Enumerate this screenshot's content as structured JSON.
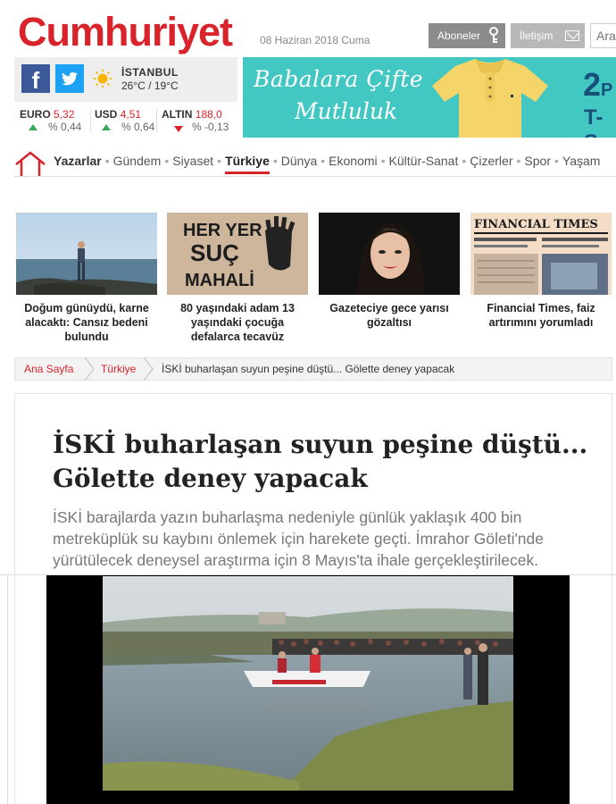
{
  "header": {
    "logo": "Cumhuriyet",
    "date": "08 Haziran 2018 Cuma",
    "subscribe_label": "Aboneler",
    "contact_label": "İletişim",
    "search_placeholder": "Ara"
  },
  "weather": {
    "city": "İSTANBUL",
    "temperature": "26°C / 19°C"
  },
  "currency": [
    {
      "name": "EURO",
      "value": "5,32",
      "change": "% 0,44",
      "direction": "up"
    },
    {
      "name": "USD",
      "value": "4,51",
      "change": "% 0,64",
      "direction": "up"
    },
    {
      "name": "ALTIN",
      "value": "188,0",
      "change": "% -0,13",
      "direction": "down"
    }
  ],
  "banner": {
    "line1": "Babalara Çifte",
    "line2": "Mutluluk",
    "promo_big": "2",
    "promo_letter": "P",
    "promo_small": "T-S"
  },
  "nav": {
    "items": [
      {
        "label": "Yazarlar",
        "style": "bold"
      },
      {
        "label": "Gündem",
        "style": ""
      },
      {
        "label": "Siyaset",
        "style": ""
      },
      {
        "label": "Türkiye",
        "style": "active"
      },
      {
        "label": "Dünya",
        "style": ""
      },
      {
        "label": "Ekonomi",
        "style": ""
      },
      {
        "label": "Kültür-Sanat",
        "style": ""
      },
      {
        "label": "Çizerler",
        "style": ""
      },
      {
        "label": "Spor",
        "style": ""
      },
      {
        "label": "Yaşam",
        "style": ""
      }
    ]
  },
  "cards": [
    {
      "caption": "Doğum günüydü, karne alacaktı: Cansız bedeni bulundu"
    },
    {
      "caption": "80 yaşındaki adam 13 yaşındaki çocuğa defalarca tecavüz",
      "img_text": [
        "HER YER",
        "SUÇ",
        "MAHALİ"
      ]
    },
    {
      "caption": "Gazeteciye gece yarısı gözaltısı"
    },
    {
      "caption": "Financial Times, faiz artırımını yorumladı",
      "img_text": [
        "FINANCIAL TIMES"
      ]
    }
  ],
  "breadcrumb": {
    "home": "Ana Sayfa",
    "section": "Türkiye",
    "current": "İSKİ buharlaşan suyun peşine düştü... Gölette deney yapacak"
  },
  "article": {
    "title": "İSKİ buharlaşan suyun peşine düştü... Gölette deney yapacak",
    "lead": "İSKİ barajlarda yazın buharlaşma nedeniyle günlük yaklaşık 400 bin metreküplük su kaybını önlemek için harekete geçti. İmrahor Göleti'nde yürütülecek deneysel araştırma için 8 Mayıs'ta ihale gerçekleştirilecek."
  },
  "colors": {
    "brand_red": "#d8232a",
    "banner_teal": "#43c7c2",
    "facebook": "#3b5998",
    "twitter": "#1da1f2"
  }
}
